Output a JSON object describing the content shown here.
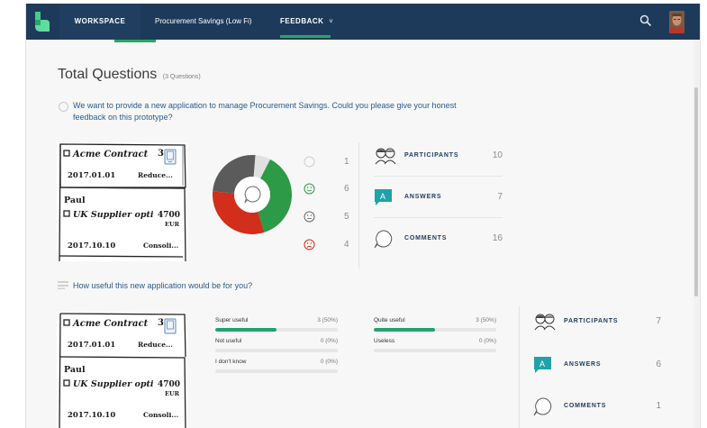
{
  "nav": {
    "workspace": "WORKSPACE",
    "project": "Procurement Savings (Low Fi)",
    "feedback": "FEEDBACK",
    "chevron": "˅",
    "search_icon": "search-icon",
    "accent_color": "#2ba468",
    "bar_color": "#1e3a5a"
  },
  "header": {
    "title": "Total Questions",
    "subtitle": "(3 Questions)"
  },
  "question1": {
    "text": "We want to provide a new application to manage Procurement Savings. Could you please give your honest feedback on this prototype?",
    "pie_values": [
      1,
      6,
      5,
      4
    ],
    "pie_colors": [
      "#e0e0e0",
      "#2c9a46",
      "#d12e1c",
      "#5b5b5b"
    ],
    "legend": [
      {
        "face": "neutral-face-icon",
        "color": "#c9c9c9",
        "count": "1"
      },
      {
        "face": "happy-face-icon",
        "color": "#2c9a46",
        "count": "6"
      },
      {
        "face": "meh-face-icon",
        "color": "#6b6b6b",
        "count": "5"
      },
      {
        "face": "sad-face-icon",
        "color": "#d12e1c",
        "count": "4"
      }
    ],
    "stats": {
      "participants_label": "PARTICIPANTS",
      "participants": "10",
      "answers_label": "ANSWERS",
      "answers": "7",
      "comments_label": "COMMENTS",
      "comments": "16"
    }
  },
  "question2": {
    "text": "How useful this new application would be for you?",
    "options": [
      {
        "label": "Super useful",
        "value": "3 (50%)",
        "pct": 50
      },
      {
        "label": "Quite useful",
        "value": "3 (50%)",
        "pct": 50
      },
      {
        "label": "Not useful",
        "value": "0 (0%)",
        "pct": 0
      },
      {
        "label": "Useless",
        "value": "0 (0%)",
        "pct": 0
      },
      {
        "label": "I don't know",
        "value": "0 (0%)",
        "pct": 0
      }
    ],
    "stats": {
      "participants_label": "PARTICIPANTS",
      "participants": "7",
      "answers_label": "ANSWERS",
      "answers": "6",
      "comments_label": "COMMENTS",
      "comments": "1"
    }
  },
  "sketch": {
    "line1": "Acme Contract",
    "line1_num": "3",
    "line2": "2017.01.01",
    "line2_b": "Reduce...",
    "line3": "Paul",
    "line4": "UK Supplier opti",
    "line4_num": "4700",
    "line4_unit": "EUR",
    "line5": "2017.10.10",
    "line5_b": "Consoli..."
  }
}
